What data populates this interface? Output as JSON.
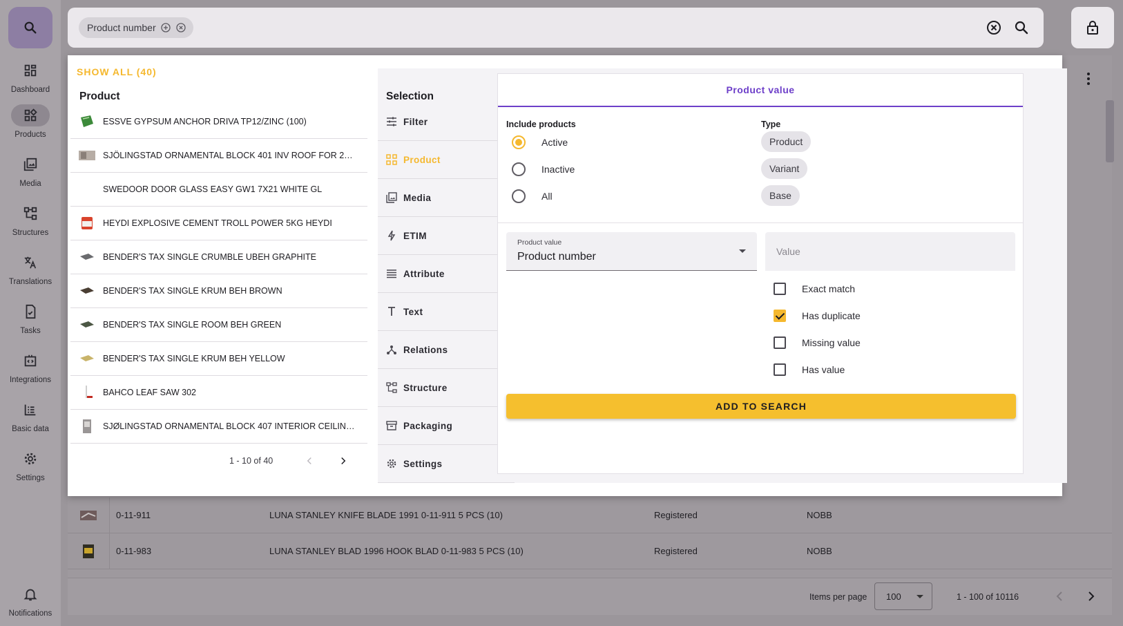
{
  "sidebar": {
    "items": [
      {
        "label": "Dashboard",
        "icon": "dashboard-icon"
      },
      {
        "label": "Products",
        "icon": "products-icon"
      },
      {
        "label": "Media",
        "icon": "media-icon"
      },
      {
        "label": "Structures",
        "icon": "structures-icon"
      },
      {
        "label": "Translations",
        "icon": "translations-icon"
      },
      {
        "label": "Tasks",
        "icon": "tasks-icon"
      },
      {
        "label": "Integrations",
        "icon": "integrations-icon"
      },
      {
        "label": "Basic data",
        "icon": "basic-data-icon"
      },
      {
        "label": "Settings",
        "icon": "settings-icon"
      },
      {
        "label": "Notifications",
        "icon": "bell-icon"
      }
    ],
    "active_item": "Products"
  },
  "search": {
    "chip_label": "Product number"
  },
  "colors": {
    "accent": "#f5b82e",
    "purple": "#6d3fc9"
  },
  "panel": {
    "show_all": "SHOW ALL (40)",
    "list_title": "Product",
    "products": [
      "ESSVE GYPSUM ANCHOR DRIVA TP12/ZINC (100)",
      "SJÖLINGSTAD ORNAMENTAL BLOCK 401 INV ROOF FOR 21...",
      "SWEDOOR DOOR GLASS EASY GW1 7X21 WHITE GL",
      "HEYDI EXPLOSIVE CEMENT TROLL POWER 5KG HEYDI",
      "BENDER'S TAX SINGLE CRUMBLE UBEH GRAPHITE",
      "BENDER'S TAX SINGLE KRUM BEH BROWN",
      "BENDER'S TAX SINGLE ROOM BEH GREEN",
      "BENDER'S TAX SINGLE KRUM BEH YELLOW",
      "BAHCO LEAF SAW 302",
      "SJØLINGSTAD ORNAMENTAL BLOCK 407 INTERIOR CEILING..."
    ],
    "pagination": "1 - 10 of 40",
    "selection_title": "Selection",
    "selection_items": [
      {
        "label": "Filter",
        "icon": "filter-icon"
      },
      {
        "label": "Product",
        "icon": "product-icon"
      },
      {
        "label": "Media",
        "icon": "media-icon"
      },
      {
        "label": "ETIM",
        "icon": "bolt-icon"
      },
      {
        "label": "Attribute",
        "icon": "lines-icon"
      },
      {
        "label": "Text",
        "icon": "text-icon"
      },
      {
        "label": "Relations",
        "icon": "relations-icon"
      },
      {
        "label": "Structure",
        "icon": "structure-icon"
      },
      {
        "label": "Packaging",
        "icon": "packaging-icon"
      },
      {
        "label": "Settings",
        "icon": "gear-icon"
      }
    ],
    "active_selection": "Product",
    "card": {
      "tab": "Product value",
      "include_label": "Include products",
      "include_options": [
        "Active",
        "Inactive",
        "All"
      ],
      "include_selected": "Active",
      "type_label": "Type",
      "type_options": [
        "Product",
        "Variant",
        "Base"
      ],
      "select_label": "Product value",
      "select_value": "Product number",
      "value_placeholder": "Value",
      "checkboxes": [
        {
          "label": "Exact match",
          "checked": false
        },
        {
          "label": "Has duplicate",
          "checked": true
        },
        {
          "label": "Missing value",
          "checked": false
        },
        {
          "label": "Has value",
          "checked": false
        }
      ],
      "add_button": "ADD TO SEARCH"
    }
  },
  "table": {
    "rows": [
      {
        "number": "0-11-911",
        "name": "LUNA STANLEY KNIFE BLADE 1991 0-11-911 5 PCS (10)",
        "status": "Registered",
        "source": "NOBB"
      },
      {
        "number": "0-11-983",
        "name": "LUNA STANLEY BLAD 1996 HOOK BLAD 0-11-983 5 PCS (10)",
        "status": "Registered",
        "source": "NOBB"
      }
    ],
    "items_per_page_label": "Items per page",
    "items_per_page": "100",
    "range": "1 - 100 of 10116"
  }
}
